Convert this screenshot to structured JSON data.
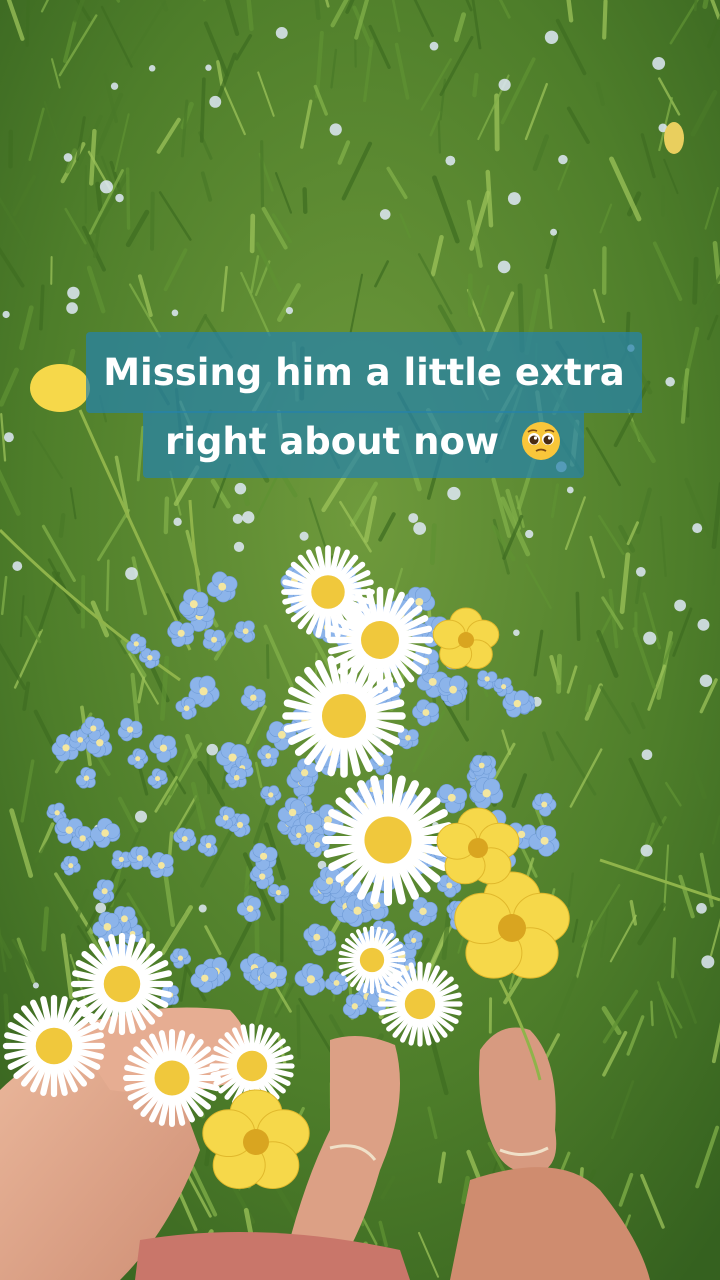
{
  "caption": {
    "line1": "Missing him a little extra",
    "line2": "right about now",
    "emoji": "pleading-face-emoji"
  },
  "scene": {
    "subject": "hand-holding-wildflower-bouquet",
    "colors": {
      "grass": "#4f7f2c",
      "forget_me_not": "#8cb4ea",
      "daisy_petal": "#ffffff",
      "daisy_center": "#f0c83c",
      "buttercup": "#f6d84a",
      "skin": "#e2a88c",
      "shorts": "#c9766a",
      "caption_bg": "#2682aa"
    }
  }
}
